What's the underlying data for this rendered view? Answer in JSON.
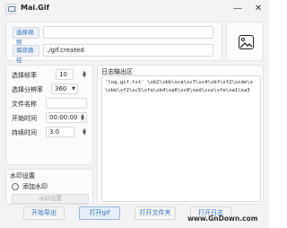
{
  "window": {
    "title": "Mai.Gif",
    "minimize_glyph": "—",
    "close_glyph": "✕"
  },
  "top": {
    "select_video_label": "选择视频",
    "video_value": "",
    "save_path_label": "保存路径",
    "save_value": "./gif.created",
    "preview_icon": "image-icon"
  },
  "settings": {
    "fps_label": "选择帧率",
    "fps_value": "10",
    "resolution_label": "选择分辨率",
    "resolution_value": "360",
    "filename_label": "文件名称",
    "filename_value": "",
    "start_label": "开始时间",
    "start_value": "00:00:00",
    "duration_label": "持续时间",
    "duration_value": "3.0"
  },
  "watermark": {
    "title": "水印设置",
    "add_label": "添加水印",
    "settings_button": "水印设置"
  },
  "log": {
    "title": "日志输出区",
    "lines": [
      "'log.gif.txt' \\xb2\\xbb\\xca\\xc7\\xc4\\xbf\\xf2\\xcde\\x",
      "\\xbb\\xf2\\xc5\\xfa\\xb4\\xa6\\xc0\\xed\\xce\\xfe\\xa1\\xa3"
    ]
  },
  "bottom": {
    "start_export": "开始导出",
    "open_gif": "打开gif",
    "open_folder": "打开文件夹",
    "open_log": "打开日志",
    "watermark_url": "www.GnDown.com"
  }
}
